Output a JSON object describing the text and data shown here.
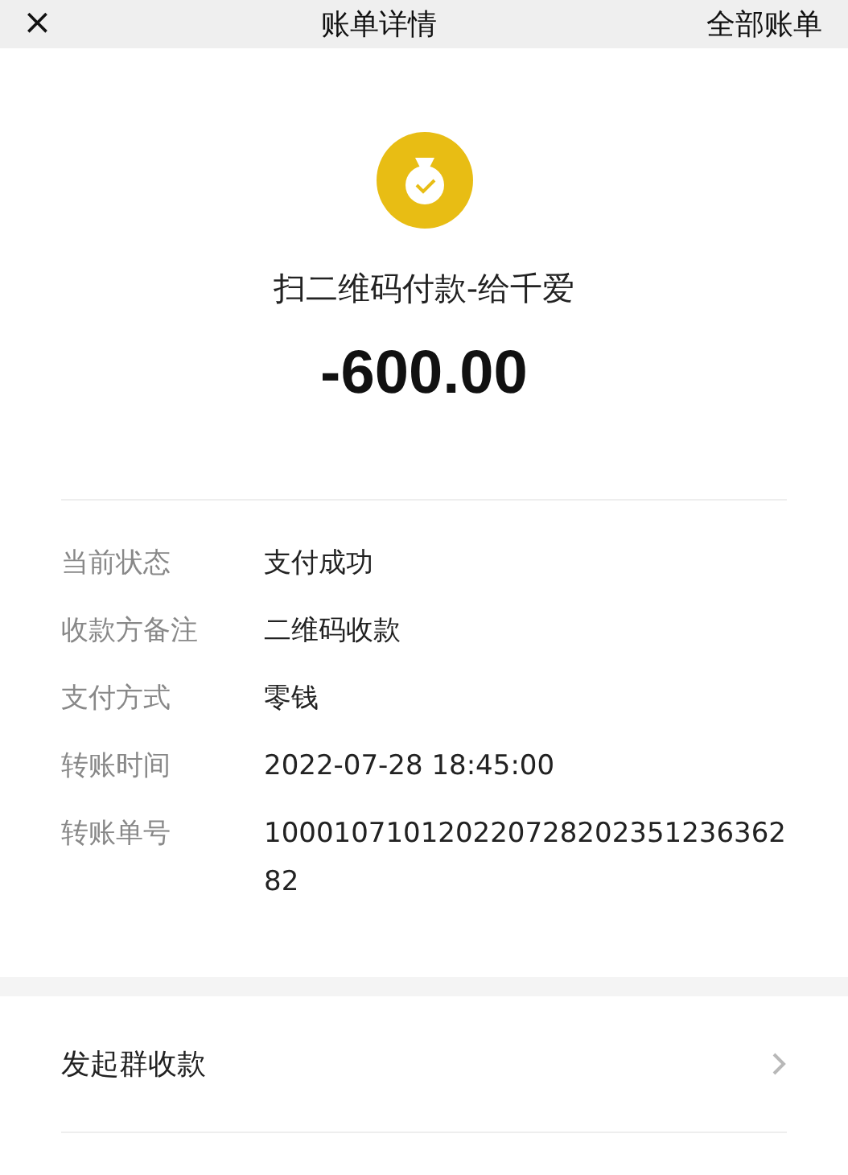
{
  "header": {
    "close": "×",
    "title": "账单详情",
    "link": "全部账单"
  },
  "summary": {
    "title": "扫二维码付款-给千爱",
    "amount": "-600.00"
  },
  "details": [
    {
      "label": "当前状态",
      "value": "支付成功"
    },
    {
      "label": "收款方备注",
      "value": "二维码收款"
    },
    {
      "label": "支付方式",
      "value": "零钱"
    },
    {
      "label": "转账时间",
      "value": "2022-07-28 18:45:00"
    },
    {
      "label": "转账单号",
      "value": "100010710120220728202351236362 82"
    }
  ],
  "actions": [
    {
      "label": "发起群收款"
    }
  ]
}
